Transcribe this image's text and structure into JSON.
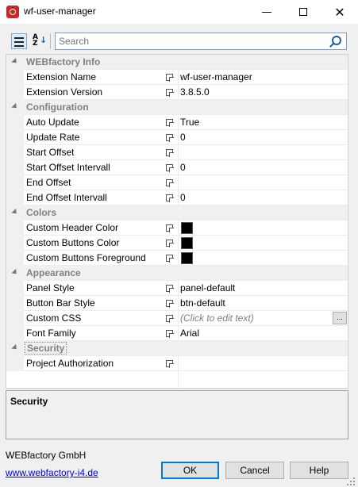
{
  "window": {
    "title": "wf-user-manager"
  },
  "search": {
    "placeholder": "Search"
  },
  "grid": {
    "categories": [
      {
        "label": "WEBfactory Info",
        "properties": [
          {
            "name": "Extension Name",
            "value": "wf-user-manager"
          },
          {
            "name": "Extension Version",
            "value": "3.8.5.0"
          }
        ]
      },
      {
        "label": "Configuration",
        "properties": [
          {
            "name": "Auto Update",
            "value": "True"
          },
          {
            "name": "Update Rate",
            "value": "0"
          },
          {
            "name": "Start Offset",
            "value": ""
          },
          {
            "name": "Start Offset Intervall",
            "value": "0"
          },
          {
            "name": "End Offset",
            "value": ""
          },
          {
            "name": "End Offset Intervall",
            "value": "0"
          }
        ]
      },
      {
        "label": "Colors",
        "properties": [
          {
            "name": "Custom Header Color",
            "swatch": "#000000"
          },
          {
            "name": "Custom Buttons Color",
            "swatch": "#000000"
          },
          {
            "name": "Custom Buttons Foreground",
            "swatch": "#000000"
          }
        ]
      },
      {
        "label": "Appearance",
        "properties": [
          {
            "name": "Panel Style",
            "value": "panel-default"
          },
          {
            "name": "Button Bar Style",
            "value": "btn-default"
          },
          {
            "name": "Custom CSS",
            "value": "(Click to edit text)",
            "ellipsis": "..."
          },
          {
            "name": "Font Family",
            "value": "Arial"
          }
        ]
      },
      {
        "label": "Security",
        "selected": true,
        "properties": [
          {
            "name": "Project Authorization",
            "value": ""
          }
        ]
      }
    ]
  },
  "description": {
    "title": "Security"
  },
  "footer": {
    "company": "WEBfactory GmbH",
    "link": "www.webfactory-i4.de",
    "ok_label": "OK",
    "cancel_label": "Cancel",
    "help_label": "Help"
  }
}
